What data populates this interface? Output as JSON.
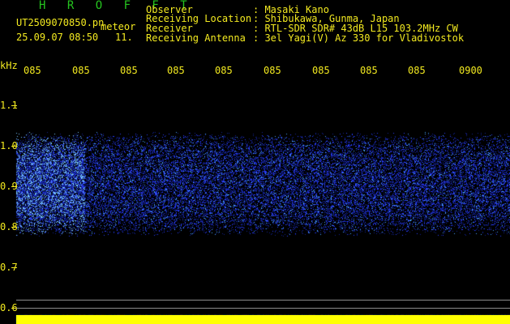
{
  "header": {
    "app_title": "H R O F F T",
    "filename": "UT2509070850.pn",
    "tag": "meteor",
    "datetime": "25.09.07 08:50",
    "count": "11.",
    "observer_label": "Observer",
    "observer_value": ": Masaki Kano",
    "location_label": "Receiving Location",
    "location_value": ": Shibukawa, Gunma, Japan",
    "receiver_label": "Receiver",
    "receiver_value": ": RTL-SDR SDR# 43dB L15 103.2MHz CW",
    "antenna_label": "Receiving Antenna",
    "antenna_value": ": 3el Yagi(V) Az 330 for Vladivostok"
  },
  "axes": {
    "y_unit": "kHz",
    "y_ticks": [
      "1.1",
      "1.0",
      "0.9",
      "0.8",
      "0.7",
      "0.6"
    ],
    "x_ticks": [
      "085",
      "085",
      "085",
      "085",
      "085",
      "085",
      "085",
      "085",
      "085",
      "0900"
    ]
  },
  "colors": {
    "background": "#000000",
    "label_yellow": "#f3ea20",
    "title_green": "#25c41f",
    "signal_blue": "#2a3cff",
    "bright_signal": "#4aa3ff"
  }
}
